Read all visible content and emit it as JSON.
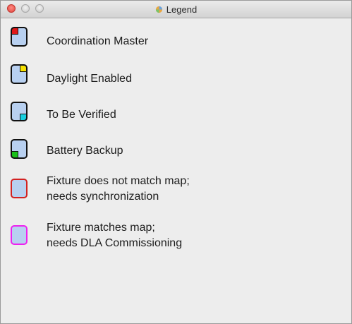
{
  "window": {
    "title": "Legend"
  },
  "legend_items": [
    {
      "icon": "coordination-master-icon",
      "indicator": "top-left",
      "indicator_color": "#e01818",
      "label_lines": [
        "Coordination Master"
      ]
    },
    {
      "icon": "daylight-enabled-icon",
      "indicator": "top-right",
      "indicator_color": "#f5e000",
      "label_lines": [
        "Daylight Enabled"
      ]
    },
    {
      "icon": "to-be-verified-icon",
      "indicator": "bottom-right",
      "indicator_color": "#18d0e0",
      "label_lines": [
        "To Be Verified"
      ]
    },
    {
      "icon": "battery-backup-icon",
      "indicator": "bottom-left",
      "indicator_color": "#18c018",
      "label_lines": [
        "Battery Backup"
      ]
    },
    {
      "icon": "fixture-mismatch-icon",
      "outline_color": "#d22222",
      "label_lines": [
        "Fixture does not match map;",
        "needs synchronization"
      ]
    },
    {
      "icon": "fixture-needs-commissioning-icon",
      "outline_color": "#ee22ee",
      "label_lines": [
        "Fixture matches map;",
        "needs DLA Commissioning"
      ]
    }
  ],
  "colors": {
    "swatch_fill": "#b8d0f0",
    "window_background": "#ededed"
  }
}
